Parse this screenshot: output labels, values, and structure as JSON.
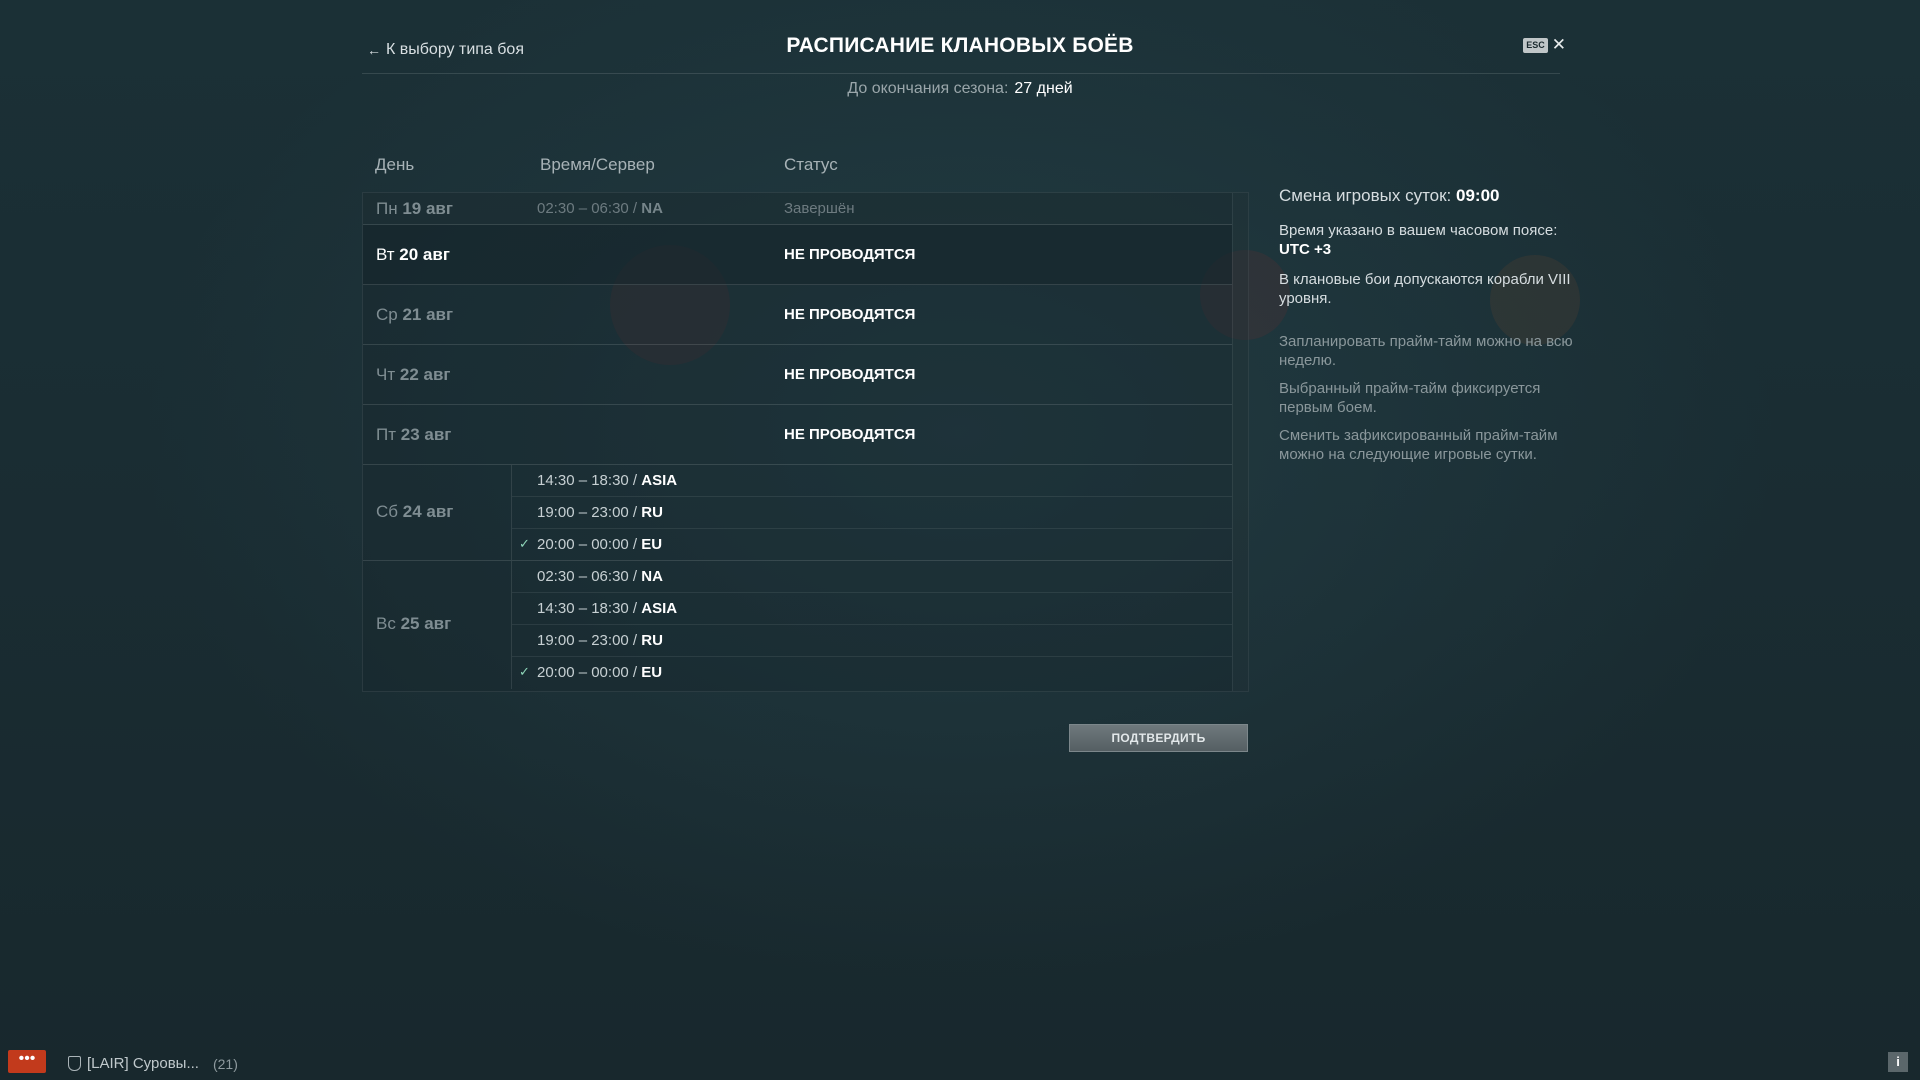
{
  "header": {
    "back_label": "К выбору типа боя",
    "title": "РАСПИСАНИЕ КЛАНОВЫХ БОЁВ",
    "esc_label": "ESC",
    "season_label": "До окончания сезона:",
    "season_value": "27 дней"
  },
  "columns": {
    "day": "День",
    "time_server": "Время/Сервер",
    "status": "Статус"
  },
  "rows": [
    {
      "weekday": "Пн",
      "date": "19 авг",
      "slot_time": "02:30 – 06:30 / ",
      "slot_server": "NA",
      "status": "Завершён"
    },
    {
      "weekday": "Вт",
      "date": "20 авг",
      "status": "НЕ ПРОВОДЯТСЯ"
    },
    {
      "weekday": "Ср",
      "date": "21 авг",
      "status": "НЕ ПРОВОДЯТСЯ"
    },
    {
      "weekday": "Чт",
      "date": "22 авг",
      "status": "НЕ ПРОВОДЯТСЯ"
    },
    {
      "weekday": "Пт",
      "date": "23 авг",
      "status": "НЕ ПРОВОДЯТСЯ"
    },
    {
      "weekday": "Сб",
      "date": "24 авг",
      "slots": [
        {
          "time": "14:30 – 18:30 / ",
          "server": "ASIA",
          "selected": false
        },
        {
          "time": "19:00 – 23:00 / ",
          "server": "RU",
          "selected": false
        },
        {
          "time": "20:00 – 00:00 / ",
          "server": "EU",
          "selected": true
        }
      ]
    },
    {
      "weekday": "Вс",
      "date": "25 авг",
      "slots": [
        {
          "time": "02:30 – 06:30 / ",
          "server": "NA",
          "selected": false
        },
        {
          "time": "14:30 – 18:30 / ",
          "server": "ASIA",
          "selected": false
        },
        {
          "time": "19:00 – 23:00 / ",
          "server": "RU",
          "selected": false
        },
        {
          "time": "20:00 – 00:00 / ",
          "server": "EU",
          "selected": true
        }
      ]
    }
  ],
  "check_glyph": "✓",
  "confirm_label": "ПОДТВЕРДИТЬ",
  "info": {
    "shift_label": "Смена игровых суток:",
    "shift_value": "09:00",
    "tz_label": "Время указано в вашем часовом поясе:",
    "tz_value": "UTC +3",
    "tier_note": "В клановые бои допускаются корабли VIII уровня.",
    "note1": "Запланировать прайм-тайм можно на всю неделю.",
    "note2": "Выбранный прайм-тайм фиксируется первым боем.",
    "note3": "Сменить зафиксированный прайм-тайм можно на следующие игровые сутки."
  },
  "footer": {
    "chat_glyph": "•••",
    "clan_label": "[LAIR] Суровы...",
    "clan_count": "(21)",
    "info_glyph": "i"
  }
}
